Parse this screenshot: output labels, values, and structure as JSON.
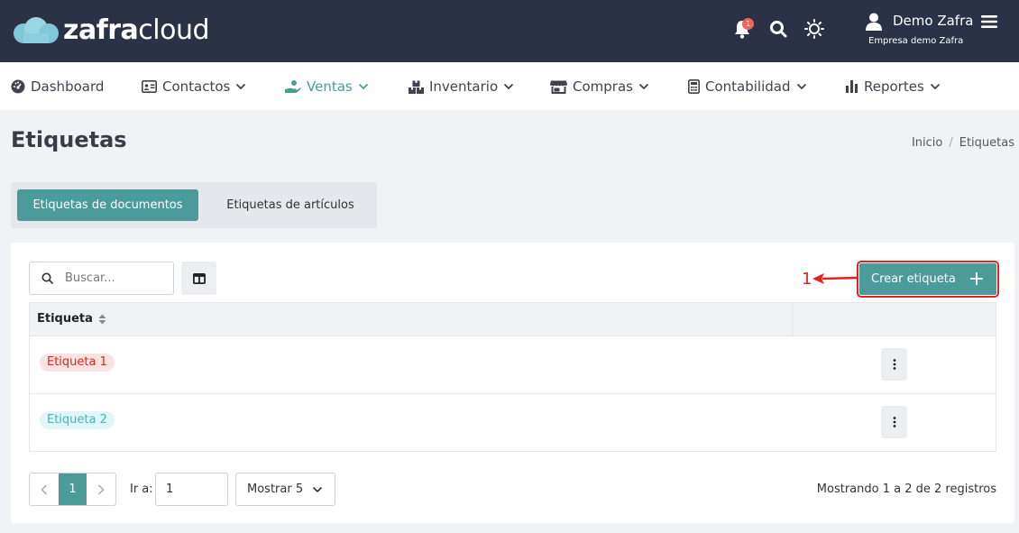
{
  "app": {
    "logo_bold": "zafra",
    "logo_light": "cloud",
    "notification_count": "1",
    "user_name": "Demo Zafra",
    "user_company": "Empresa demo Zafra"
  },
  "nav": {
    "items": [
      {
        "label": "Dashboard",
        "icon": "dashboard-icon"
      },
      {
        "label": "Contactos",
        "icon": "contact-card-icon"
      },
      {
        "label": "Ventas",
        "icon": "hand-money-icon",
        "active": true
      },
      {
        "label": "Inventario",
        "icon": "boxes-icon"
      },
      {
        "label": "Compras",
        "icon": "store-icon"
      },
      {
        "label": "Contabilidad",
        "icon": "calculator-icon"
      },
      {
        "label": "Reportes",
        "icon": "bar-chart-icon"
      }
    ]
  },
  "page": {
    "title": "Etiquetas",
    "breadcrumb": [
      "Inicio",
      "Etiquetas"
    ]
  },
  "tabs": [
    "Etiquetas de documentos",
    "Etiquetas de artículos"
  ],
  "toolbar": {
    "search_placeholder": "Buscar...",
    "create_label": "Crear etiqueta",
    "annotation": "1"
  },
  "table": {
    "column": "Etiqueta",
    "rows": [
      {
        "label": "Etiqueta 1",
        "color": "#d9271e"
      },
      {
        "label": "Etiqueta 2",
        "color": "#3fb8b8"
      }
    ]
  },
  "pagination": {
    "current_page": "1",
    "goto_label": "Ir a:",
    "goto_value": "1",
    "show_label": "Mostrar 5",
    "records": "Mostrando 1 a 2 de 2 registros"
  },
  "colors": {
    "accent": "#4c9b9b",
    "topbar": "#2c3245",
    "annotation": "#e3211f"
  }
}
